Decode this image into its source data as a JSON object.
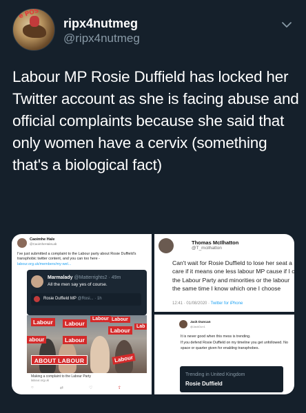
{
  "header": {
    "display_name": "ripx4nutmeg",
    "handle": "@ripx4nutmeg",
    "avatar_logo_text": "e POS"
  },
  "tweet": {
    "text": "Labour MP Rosie Duffield has locked her Twitter account as she is facing abuse and official complaints because she said that only women have a cervix (something that's a biological fact)"
  },
  "media": {
    "img1": {
      "author_name": "Caoimhe Hale",
      "author_handle": "@CaoimheHaleLab",
      "body": "I've just submitted a complaint to the Labour party about Rosie Duffield's transphobic twitter content, and you can too here -",
      "link": "labour.org.uk/members/my-wel...",
      "quote_name": "Marmalady",
      "quote_meta": "@Matterrights2 · 49m",
      "quote_text": "All the men say yes of course.",
      "inner_name": "Rosie Duffield MP",
      "inner_meta": "@Rosi... · 1h",
      "signs": [
        "Labour",
        "Labour",
        "Labour",
        "Labour",
        "Labour",
        "Lab",
        "abour",
        "Labour",
        "Labour"
      ],
      "banner": "ABOUT LABOUR",
      "caption": "Making a complaint to the Labour Party",
      "caption_url": "labour.org.uk",
      "actions": [
        "○",
        "⇄",
        "♡",
        "⇪"
      ]
    },
    "img2": {
      "author_name": "Thomas McIlhatton",
      "author_handle": "@T_mcilhatton",
      "lines": [
        "Can't wait for Rosie Duffield to lose her seat a",
        "care if it means one less labour MP cause if I c",
        "the Labour Party and minorities or the labour",
        "the same time I know which one I choose"
      ],
      "date": "12:41 · 01/08/2020 ·",
      "via": "Twitter for iPhone"
    },
    "img3": {
      "author_name": "Jack Duncan",
      "author_handle": "@JackDun1",
      "body_1": "It is never good when this mess is trending.",
      "body_2": "If you defend Rosie Duffield on my timeline you get unfollowed. No space or quarter given for enabling transphobes.",
      "trend_label": "Trending in United Kingdom",
      "trend_value": "Rosie Duffield"
    }
  },
  "colors": {
    "background": "#15202b",
    "secondary_text": "#8899a6",
    "labour_red": "#d42a2a",
    "link_blue": "#1da1f2"
  }
}
